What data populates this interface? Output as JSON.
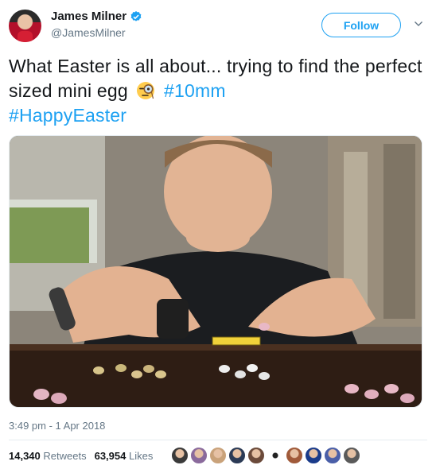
{
  "author": {
    "display_name": "James Milner",
    "handle": "@JamesMilner",
    "verified_icon": "verified-badge-icon"
  },
  "actions": {
    "follow_label": "Follow",
    "more_icon": "chevron-down-icon"
  },
  "tweet": {
    "text_part1": "What Easter is all about... trying to find the perfect sized mini egg",
    "emoji": "face-with-monocle-icon",
    "hashtag1": "#10mm",
    "hashtag2": "#HappyEaster"
  },
  "media": {
    "image_content": "photo"
  },
  "meta": {
    "timestamp": "3:49 pm - 1 Apr 2018"
  },
  "stats": {
    "retweets_count": "14,340",
    "retweets_label": "Retweets",
    "likes_count": "63,954",
    "likes_label": "Likes"
  },
  "colors": {
    "accent": "#1da1f2",
    "text": "#14171a",
    "muted": "#657786",
    "divider": "#e6ecf0"
  },
  "likers": [
    {
      "color": "#3a3a3a"
    },
    {
      "color": "#8a6a9c"
    },
    {
      "color": "#c9a27a"
    },
    {
      "color": "#2b3a55"
    },
    {
      "color": "#6b4a3a"
    },
    {
      "color": "#ffffff"
    },
    {
      "color": "#a05a3a"
    },
    {
      "color": "#1a3b8a"
    },
    {
      "color": "#4a5fa8"
    },
    {
      "color": "#5a5a5a"
    }
  ]
}
